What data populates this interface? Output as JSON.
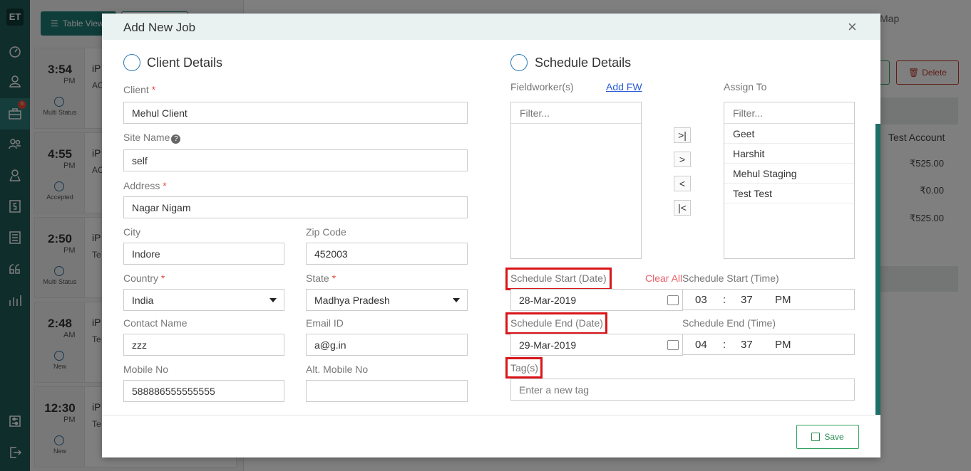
{
  "sidebar": {
    "logo": "ET",
    "badge": "5"
  },
  "background": {
    "table_view_label": "Table View",
    "map_tab": "Map",
    "delete_label": "Delete",
    "account": "Test Account",
    "amounts": [
      "₹525.00",
      "₹0.00",
      "₹525.00"
    ],
    "jobs": [
      {
        "time": "3:54",
        "ampm": "PM",
        "status": "Multi Status",
        "title": "iP",
        "line2": "AC"
      },
      {
        "time": "4:55",
        "ampm": "PM",
        "status": "Accepted",
        "title": "iP",
        "line2": "AC"
      },
      {
        "time": "2:50",
        "ampm": "PM",
        "status": "Multi Status",
        "title": "iP",
        "line2": "Te"
      },
      {
        "time": "2:48",
        "ampm": "AM",
        "status": "New",
        "title": "iP",
        "line2": "Te"
      },
      {
        "time": "12:30",
        "ampm": "PM",
        "status": "New",
        "title": "iP",
        "line2": "Te"
      }
    ]
  },
  "modal": {
    "title": "Add New Job",
    "close": "×",
    "client": {
      "section_title": "Client Details",
      "client_label": "Client",
      "client_value": "Mehul Client",
      "site_label": "Site Name",
      "site_value": "self",
      "address_label": "Address",
      "address_value": "Nagar Nigam",
      "city_label": "City",
      "city_value": "Indore",
      "zip_label": "Zip Code",
      "zip_value": "452003",
      "country_label": "Country",
      "country_value": "India",
      "state_label": "State",
      "state_value": "Madhya Pradesh",
      "contact_label": "Contact Name",
      "contact_value": "zzz",
      "email_label": "Email ID",
      "email_value": "a@g.in",
      "mobile_label": "Mobile No",
      "mobile_value": "588886555555555",
      "alt_mobile_label": "Alt. Mobile No",
      "alt_mobile_value": ""
    },
    "schedule": {
      "section_title": "Schedule Details",
      "fieldworkers_label": "Fieldworker(s)",
      "add_fw": "Add FW",
      "assign_label": "Assign To",
      "filter_placeholder": "Filter...",
      "assignees": [
        "Geet",
        "Harshit",
        "Mehul Staging",
        "Test Test"
      ],
      "start_date_label": "Schedule Start (Date)",
      "clear_all": "Clear All",
      "start_time_label": "Schedule Start (Time)",
      "start_date": "28-Mar-2019",
      "start_hour": "03",
      "start_min": "37",
      "start_ampm": "PM",
      "end_date_label": "Schedule End (Date)",
      "end_time_label": "Schedule End (Time)",
      "end_date": "29-Mar-2019",
      "end_hour": "04",
      "end_min": "37",
      "end_ampm": "PM",
      "tags_label": "Tag(s)",
      "tags_placeholder": "Enter a new tag"
    },
    "save_label": "Save"
  }
}
